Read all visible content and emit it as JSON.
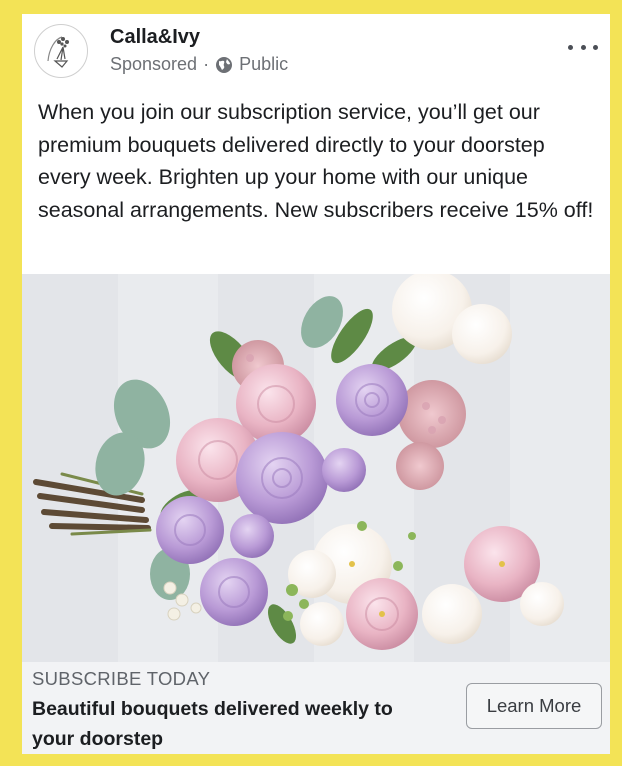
{
  "post": {
    "page_name": "Calla&Ivy",
    "sponsored_label": "Sponsored",
    "separator": "·",
    "audience": "Public",
    "text": "When you join our subscription service, you’ll get our premium bouquets delivered directly to your doorstep every week. Brighten up your home with our unique seasonal arrangements. New subscribers receive 15% off!"
  },
  "icons": {
    "avatar": "flower-bouquet-logo-icon",
    "audience": "globe-icon",
    "menu": "more-options-icon"
  },
  "media": {
    "content": "bouquet-photo",
    "colors": {
      "lilac": "#b99ad6",
      "pink": "#e9b4c4",
      "cream": "#f7f1ea",
      "green": "#6d8f4e",
      "eucalyptus": "#8fb3a1"
    }
  },
  "cta": {
    "caption": "SUBSCRIBE TODAY",
    "headline": "Beautiful bouquets delivered weekly to your doorstep",
    "button_label": "Learn More"
  },
  "colors": {
    "frame": "#f3e356",
    "card": "#ffffff",
    "footer": "#f2f3f5"
  }
}
